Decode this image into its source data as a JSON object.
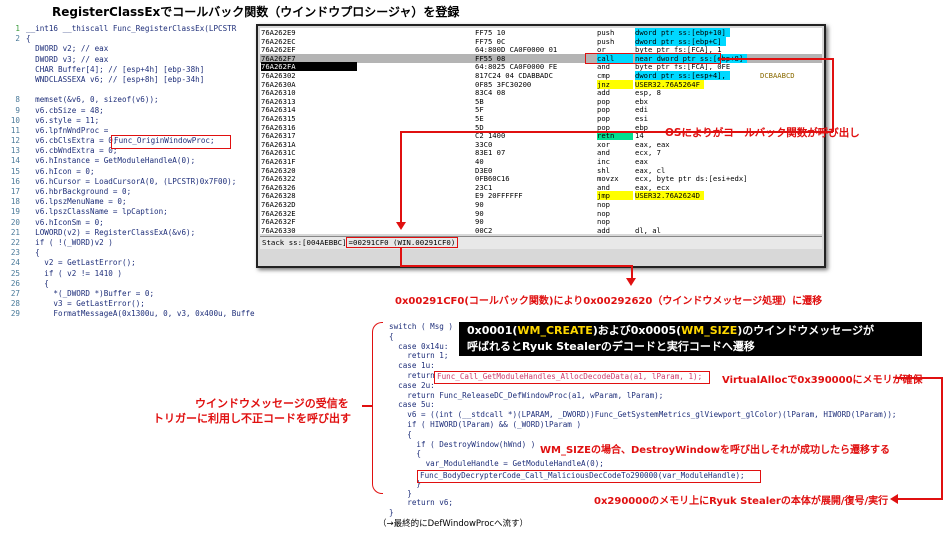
{
  "title": "RegisterClassExでコールバック関数（ウインドウプロシージャ）を登録",
  "source_code": [
    {
      "n": "1",
      "t": "__int16 __thiscall Func_RegisterClassEx(LPCSTR"
    },
    {
      "n": "2",
      "t": "{"
    },
    {
      "n": "",
      "t": "  DWORD v2; // eax"
    },
    {
      "n": "",
      "t": "  DWORD v3; // eax"
    },
    {
      "n": "",
      "t": "  CHAR Buffer[4]; // [esp+4h] [ebp-38h]"
    },
    {
      "n": "",
      "t": "  WNDCLASSEXA v6; // [esp+8h] [ebp-34h]"
    },
    {
      "n": "",
      "t": ""
    },
    {
      "n": "8",
      "t": "  memset(&v6, 0, sizeof(v6));"
    },
    {
      "n": "9",
      "t": "  v6.cbSize = 48;"
    },
    {
      "n": "10",
      "t": "  v6.style = 11;"
    },
    {
      "n": "11",
      "t": "  v6.lpfnWndProc ="
    },
    {
      "n": "12",
      "t": "  v6.cbClsExtra = 0;"
    },
    {
      "n": "13",
      "t": "  v6.cbWndExtra = 0;"
    },
    {
      "n": "14",
      "t": "  v6.hInstance = GetModuleHandleA(0);"
    },
    {
      "n": "15",
      "t": "  v6.hIcon = 0;"
    },
    {
      "n": "16",
      "t": "  v6.hCursor = LoadCursorA(0, (LPCSTR)0x7F00);"
    },
    {
      "n": "17",
      "t": "  v6.hbrBackground = 0;"
    },
    {
      "n": "18",
      "t": "  v6.lpszMenuName = 0;"
    },
    {
      "n": "19",
      "t": "  v6.lpszClassName = lpCaption;"
    },
    {
      "n": "20",
      "t": "  v6.hIconSm = 0;"
    },
    {
      "n": "21",
      "t": "  LOWORD(v2) = RegisterClassExA(&v6);"
    },
    {
      "n": "22",
      "t": "  if ( !(_WORD)v2 )"
    },
    {
      "n": "23",
      "t": "  {"
    },
    {
      "n": "24",
      "t": "    v2 = GetLastError();"
    },
    {
      "n": "25",
      "t": "    if ( v2 != 1410 )"
    },
    {
      "n": "26",
      "t": "    {"
    },
    {
      "n": "27",
      "t": "      *(_DWORD *)Buffer = 0;"
    },
    {
      "n": "28",
      "t": "      v3 = GetLastError();"
    },
    {
      "n": "29",
      "t": "      FormatMessageA(0x1300u, 0, v3, 0x400u, Buffer, 0, 0);"
    }
  ],
  "origin_proc_label": "Func_OriginWindowProc;",
  "debugger": {
    "rows": [
      {
        "addr": "76A262E9",
        "hex": "FF75 10",
        "mn": "push",
        "op": "dword ptr ss:[ebp+10]",
        "cmt": "",
        "style": "",
        "ophl": "cyan"
      },
      {
        "addr": "76A262EC",
        "hex": "FF75 0C",
        "mn": "push",
        "op": "dword ptr ss:[ebp+C]",
        "cmt": "",
        "style": "",
        "ophl": "cyan"
      },
      {
        "addr": "76A262EF",
        "hex": "64:800D CA0F0000 01",
        "mn": "or",
        "op": "byte ptr fs:[FCA], 1",
        "cmt": "",
        "style": "",
        "ophl": ""
      },
      {
        "addr": "76A262F7",
        "hex": "FF55 08",
        "mn": "call",
        "op": "near dword ptr ss:[ebp+8]",
        "cmt": "",
        "style": "sel",
        "ophl": "cyan",
        "mnhl": "cyan"
      },
      {
        "addr": "76A262FA",
        "hex": "64:8025 CA0F0000 FE",
        "mn": "and",
        "op": "byte ptr fs:[FCA], 0FE",
        "cmt": "",
        "style": "blk",
        "ophl": ""
      },
      {
        "addr": "76A26302",
        "hex": "817C24 04 CDABBADC",
        "mn": "cmp",
        "op": "dword ptr ss:[esp+4],",
        "cmt": "DCBAABCD",
        "style": "",
        "ophl": "cyan"
      },
      {
        "addr": "76A2630A",
        "hex": "0F85 3FC30200",
        "mn": "jnz",
        "op": "USER32.76A5264F",
        "cmt": "",
        "style": "",
        "ophl": "yel",
        "mnhl": "yel"
      },
      {
        "addr": "76A26310",
        "hex": "83C4 08",
        "mn": "add",
        "op": "esp, 8",
        "cmt": "",
        "style": "",
        "ophl": ""
      },
      {
        "addr": "76A26313",
        "hex": "5B",
        "mn": "pop",
        "op": "ebx",
        "cmt": "",
        "style": "",
        "ophl": ""
      },
      {
        "addr": "76A26314",
        "hex": "5F",
        "mn": "pop",
        "op": "edi",
        "cmt": "",
        "style": "",
        "ophl": ""
      },
      {
        "addr": "76A26315",
        "hex": "5E",
        "mn": "pop",
        "op": "esi",
        "cmt": "",
        "style": "",
        "ophl": ""
      },
      {
        "addr": "76A26316",
        "hex": "5D",
        "mn": "pop",
        "op": "ebp",
        "cmt": "",
        "style": "",
        "ophl": ""
      },
      {
        "addr": "76A26317",
        "hex": "C2 1400",
        "mn": "retn",
        "op": "14",
        "cmt": "",
        "style": "",
        "ophl": "",
        "mnhl": "grn"
      },
      {
        "addr": "76A2631A",
        "hex": "33C0",
        "mn": "xor",
        "op": "eax, eax",
        "cmt": "",
        "style": "",
        "ophl": ""
      },
      {
        "addr": "76A2631C",
        "hex": "83E1 07",
        "mn": "and",
        "op": "ecx, 7",
        "cmt": "",
        "style": "",
        "ophl": ""
      },
      {
        "addr": "76A2631F",
        "hex": "40",
        "mn": "inc",
        "op": "eax",
        "cmt": "",
        "style": "",
        "ophl": ""
      },
      {
        "addr": "76A26320",
        "hex": "D3E0",
        "mn": "shl",
        "op": "eax, cl",
        "cmt": "",
        "style": "",
        "ophl": ""
      },
      {
        "addr": "76A26322",
        "hex": "0FB60C16",
        "mn": "movzx",
        "op": "ecx, byte ptr ds:[esi+edx]",
        "cmt": "",
        "style": "",
        "ophl": ""
      },
      {
        "addr": "76A26326",
        "hex": "23C1",
        "mn": "and",
        "op": "eax, ecx",
        "cmt": "",
        "style": "",
        "ophl": ""
      },
      {
        "addr": "76A26328",
        "hex": "E9 20FFFFFF",
        "mn": "jmp",
        "op": "USER32.76A2624D",
        "cmt": "",
        "style": "",
        "ophl": "yel",
        "mnhl": "yel"
      },
      {
        "addr": "76A2632D",
        "hex": "90",
        "mn": "nop",
        "op": "",
        "cmt": "",
        "style": "",
        "ophl": ""
      },
      {
        "addr": "76A2632E",
        "hex": "90",
        "mn": "nop",
        "op": "",
        "cmt": "",
        "style": "",
        "ophl": ""
      },
      {
        "addr": "76A2632F",
        "hex": "90",
        "mn": "nop",
        "op": "",
        "cmt": "",
        "style": "",
        "ophl": ""
      },
      {
        "addr": "76A26330",
        "hex": "00C2",
        "mn": "add",
        "op": "dl, al",
        "cmt": "",
        "style": "",
        "ophl": ""
      }
    ],
    "stack_prefix": "Stack ss:[004AEBBC]",
    "stack_value": "=00291CF0 (WIN.00291CF0)"
  },
  "notes": {
    "os_callback": "OSによりがコールバック関数が呼び出し",
    "transition": "0x00291CF0(コールバック関数)により0x00292620（ウインドウメッセージ処理）に遷移",
    "trigger_line1": "ウインドウメッセージの受信を",
    "trigger_line2": "トリガーに利用し不正コードを呼び出す",
    "virtualalloc": "VirtualAllocで0x390000にメモリが確保",
    "wm_size": "WM_SIZEの場合、DestroyWindowを呼び出しそれが成功したら遷移する",
    "expand": "0x290000のメモリ上にRyuk Stealerの本体が展開/復号/実行"
  },
  "blackbox": {
    "p1": "0x0001(",
    "w1": "WM_CREATE",
    "p2": ")および0x0005(",
    "w2": "WM_SIZE",
    "p3": ")のウインドウメッセージが",
    "line2": "呼ばれるとRyuk Stealerのデコードと実行コードへ遷移"
  },
  "code_lines": [
    "switch ( Msg )",
    "{",
    "  case 0x14u:",
    "    return 1;",
    "  case 1u:",
    "    return",
    "  case 2u:",
    "    return Func_ReleaseDC_DefWindowProc(a1, wParam, lParam);",
    "  case 5u:",
    "    v6 = ((int (__stdcall *)(LPARAM, _DWORD))Func_GetSystemMetrics_glViewport_glColor)(lParam, HIWORD(lParam));",
    "    if ( HIWORD(lParam) && (_WORD)lParam )",
    "    {",
    "      if ( DestroyWindow(hWnd) )",
    "      {",
    "        var_ModuleHandle = GetModuleHandleA(0);",
    "",
    "      }",
    "    }",
    "    return v6;",
    "}"
  ],
  "alloc_call": "Func_Call_GetModuleHandles_AllocDecodeData(a1, lParam, 1);",
  "decrypt_call": "Func_BodyDecrypterCode_Call_MaliciousDecCodeTo290000(var_ModuleHandle);",
  "final_note": "（→最終的にDefWindowProcへ流す）"
}
